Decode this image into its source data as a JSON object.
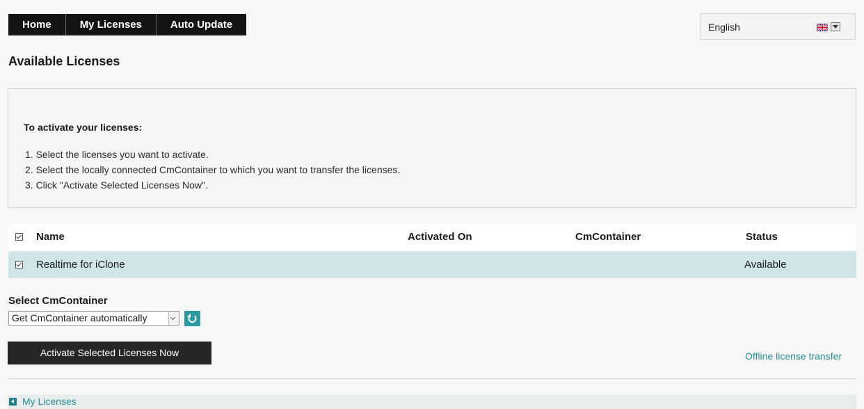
{
  "nav": {
    "items": [
      {
        "label": "Home"
      },
      {
        "label": "My Licenses"
      },
      {
        "label": "Auto Update"
      }
    ]
  },
  "language": {
    "selected": "English",
    "flag_icon": "uk-flag-icon",
    "arrow_icon": "dropdown-arrow-icon"
  },
  "page_title": "Available Licenses",
  "instructions": {
    "title": "To activate your licenses:",
    "steps": [
      "1. Select the licenses you want to activate.",
      "2. Select the locally connected CmContainer to which you want to transfer the licenses.",
      "3. Click \"Activate Selected Licenses Now\"."
    ]
  },
  "table": {
    "headers": {
      "name": "Name",
      "activated_on": "Activated On",
      "cmcontainer": "CmContainer",
      "status": "Status"
    },
    "rows": [
      {
        "checked": true,
        "name": "Realtime for iClone",
        "activated_on": "",
        "cmcontainer": "",
        "status": "Available"
      }
    ],
    "row_highlight_color": "#cfe5e8"
  },
  "container_select": {
    "label": "Select CmContainer",
    "selected": "Get CmContainer automatically",
    "refresh_icon": "refresh-icon"
  },
  "actions": {
    "activate_label": "Activate Selected Licenses Now",
    "offline_link": "Offline license transfer"
  },
  "footer": {
    "back_label": "My Licenses",
    "back_icon": "back-arrow-icon"
  },
  "colors": {
    "accent": "#2a8f99",
    "nav_bg": "#141414",
    "button_bg": "#262626"
  }
}
